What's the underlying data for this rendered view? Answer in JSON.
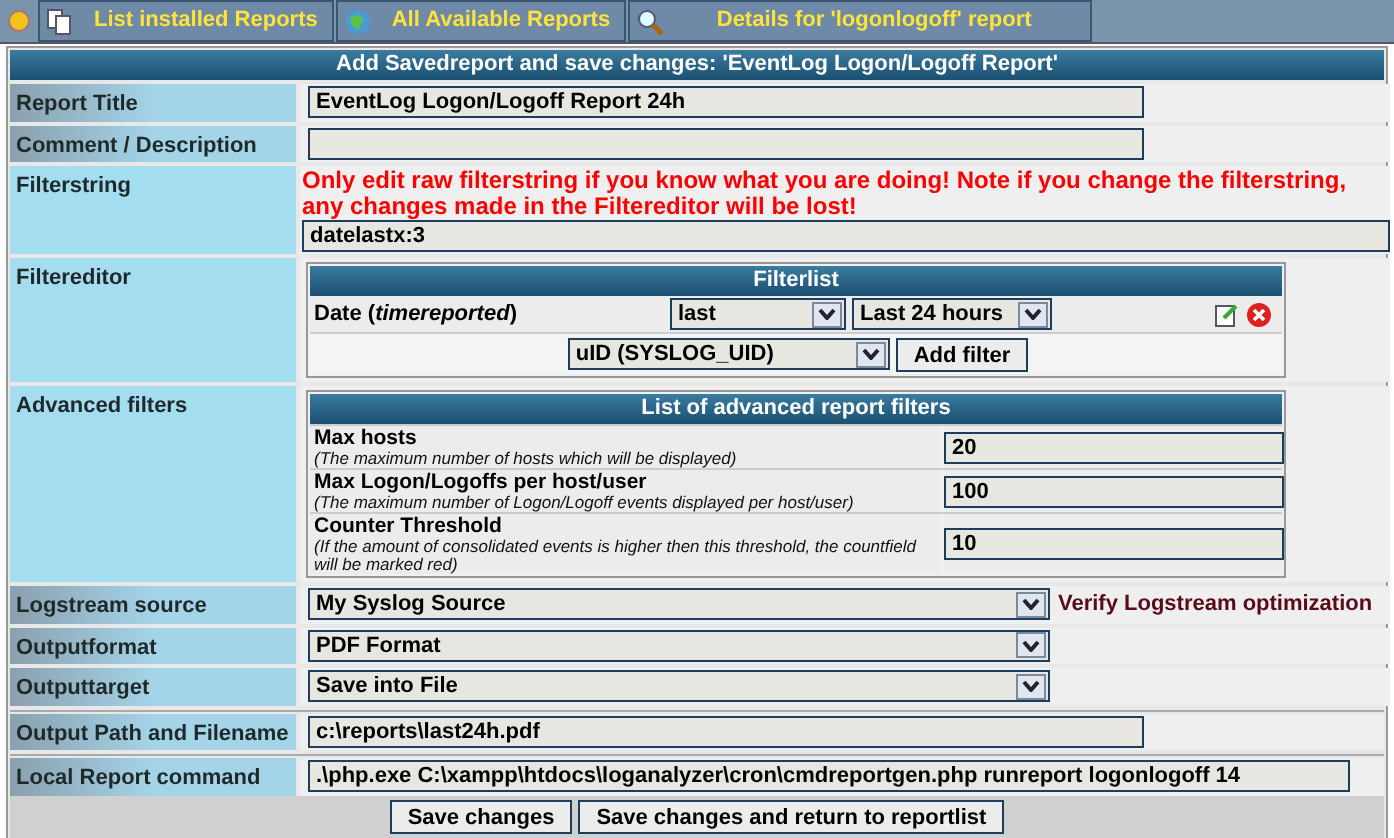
{
  "nav": {
    "tabs": [
      {
        "label": "List installed Reports"
      },
      {
        "label": "All Available Reports"
      },
      {
        "label": "Details for 'logonlogoff' report"
      }
    ]
  },
  "form": {
    "title": "Add Savedreport and save changes: 'EventLog Logon/Logoff Report'",
    "report_title": {
      "label": "Report Title",
      "value": "EventLog Logon/Logoff Report 24h"
    },
    "comment": {
      "label": "Comment / Description"
    },
    "filterstring": {
      "label": "Filterstring",
      "warning": "Only edit raw filterstring if you know what you are doing! Note if you change the filterstring, any changes made in the Filtereditor will be lost!",
      "value": "datelastx:3"
    },
    "filtereditor": {
      "label": "Filtereditor",
      "title": "Filterlist",
      "filters": [
        {
          "name": "Date (*timereported*)",
          "operator": "last",
          "range": "Last 24 hours"
        }
      ],
      "new_field": "uID (SYSLOG_UID)",
      "add_button": "Add filter"
    },
    "advanced": {
      "label": "Advanced filters",
      "title": "List of advanced report filters",
      "items": [
        {
          "name": "Max hosts",
          "hint": "(The maximum number of hosts which will be displayed)",
          "value": "20"
        },
        {
          "name": "Max Logon/Logoffs per host/user",
          "hint": "(The maximum number of Logon/Logoff events displayed per host/user)",
          "value": "100"
        },
        {
          "name": "Counter Threshold",
          "hint": "(If the amount of consolidated events is higher then this threshold, the countfield will be marked red)",
          "value": "10"
        }
      ]
    },
    "selects": [
      {
        "label": "Logstream source",
        "value": "My Syslog Source",
        "link": "Verify Logstream optimization"
      },
      {
        "label": "Outputformat",
        "value": "PDF Format"
      },
      {
        "label": "Outputtarget",
        "value": "Save into File"
      }
    ],
    "output_path": {
      "label": "Output Path and Filename",
      "value": "c:\\reports\\last24h.pdf"
    },
    "command": {
      "label": "Local Report command",
      "value": ".\\php.exe C:\\xampp\\htdocs\\loganalyzer\\cron\\cmdreportgen.php runreport logonlogoff 14"
    },
    "buttons": [
      "Save changes",
      "Save changes and return to reportlist"
    ]
  }
}
